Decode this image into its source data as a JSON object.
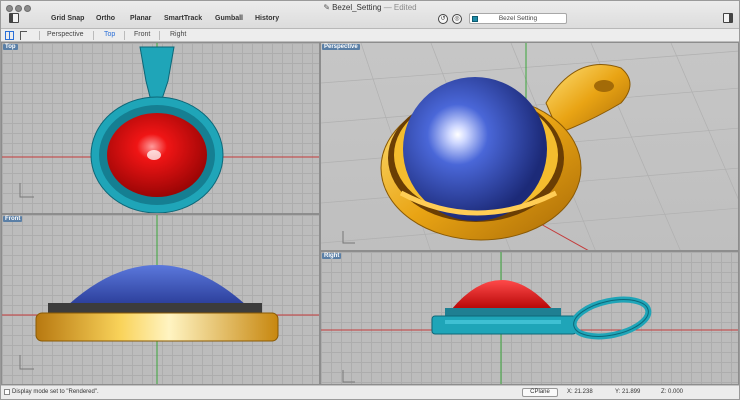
{
  "window": {
    "title": "Bezel_Setting",
    "title_suffix": "— Edited",
    "doc_icon": "✎"
  },
  "toolbar": {
    "buttons": [
      "Grid Snap",
      "Ortho",
      "Planar",
      "SmartTrack",
      "Gumball",
      "History"
    ],
    "command_field": "Bezel Setting"
  },
  "viewport_tabs": {
    "items": [
      "Perspective",
      "Top",
      "Front",
      "Right"
    ],
    "active": "Top"
  },
  "viewports": {
    "top": "Top",
    "perspective": "Perspective",
    "front": "Front",
    "right": "Right"
  },
  "status": {
    "message": "Display mode set to \"Rendered\".",
    "cplane": "CPlane",
    "x": "X: 21.238",
    "y": "Y: 21.899",
    "z": "Z: 0.000"
  },
  "colors": {
    "gem_red": "#e01010",
    "gem_blue": "#3a57c8",
    "gold": "#f2b21c",
    "teal": "#1fa5b8",
    "axis_red": "#c43a3a",
    "axis_green": "#3aa63a"
  }
}
